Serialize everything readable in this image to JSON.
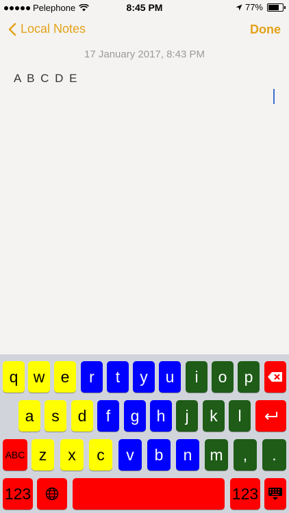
{
  "status": {
    "carrier": "Pelephone",
    "time": "8:45 PM",
    "battery": "77%",
    "battery_level": 0.77
  },
  "nav": {
    "back_label": "Local Notes",
    "done_label": "Done"
  },
  "note": {
    "timestamp": "17 January 2017, 8:43 PM",
    "body": "A B C D E"
  },
  "colors": {
    "accent": "#e3a21a",
    "yellow": "#ffff00",
    "blue": "#0000ff",
    "green": "#1e5c17",
    "red": "#ff0000"
  },
  "keyboard": {
    "row1": [
      "q",
      "w",
      "e",
      "r",
      "t",
      "y",
      "u",
      "i",
      "o",
      "p"
    ],
    "row2": [
      "a",
      "s",
      "d",
      "f",
      "g",
      "h",
      "j",
      "k",
      "l"
    ],
    "row3": [
      "z",
      "x",
      "c",
      "v",
      "b",
      "n",
      "m",
      ",",
      "."
    ],
    "shift_label": "ABC",
    "numbers_label": "123",
    "numbers_right_label": "123",
    "icons": {
      "delete": "delete-icon",
      "return": "return-icon",
      "globe": "globe-icon",
      "dismiss": "keyboard-dismiss-icon"
    }
  }
}
